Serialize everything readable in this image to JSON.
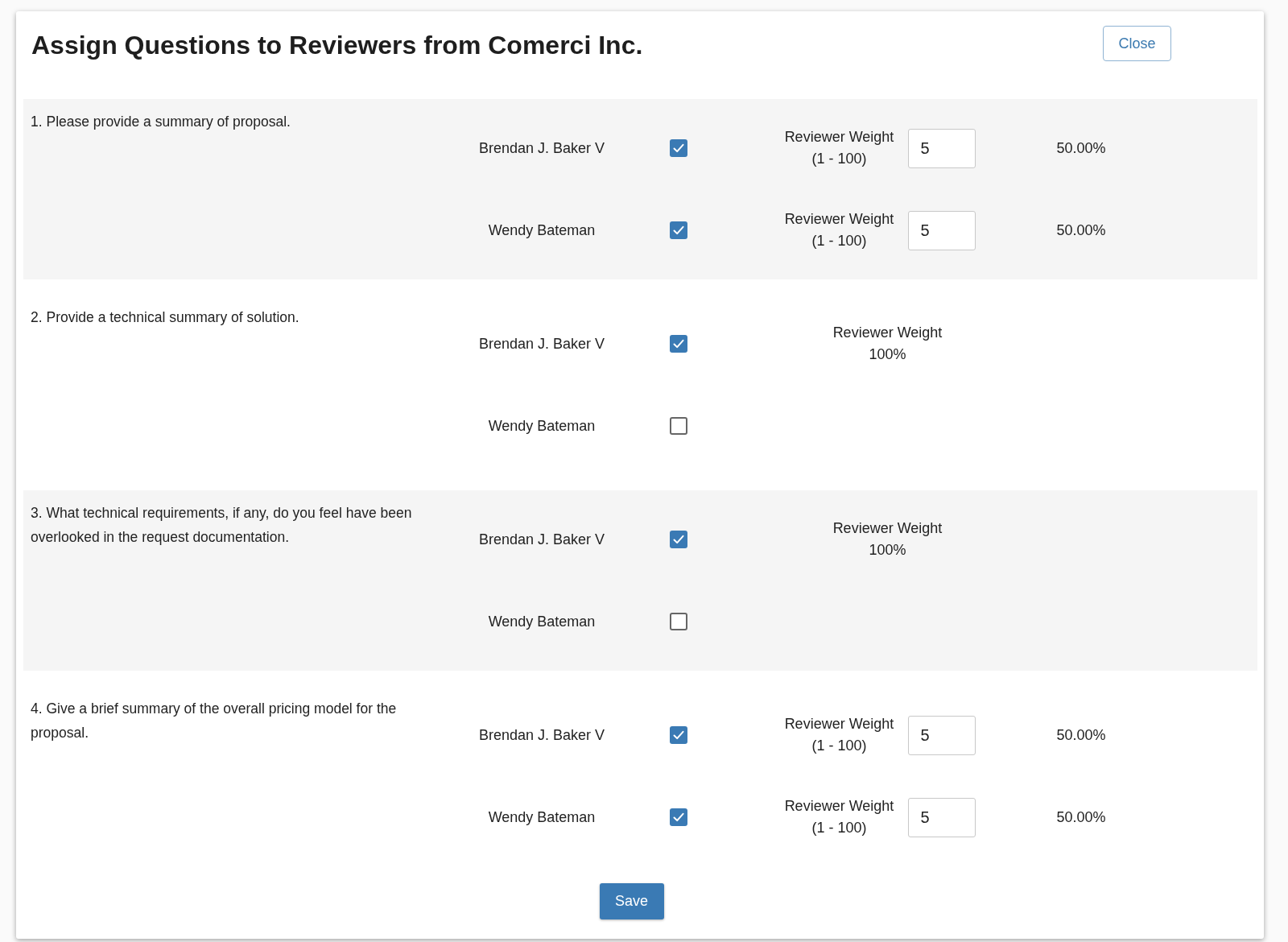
{
  "dialog": {
    "title": "Assign Questions to Reviewers from Comerci Inc.",
    "close_button": "Close"
  },
  "questions": [
    {
      "text": "1. Please provide a summary of proposal.",
      "reviewers": [
        {
          "name": "Brendan J. Baker V",
          "checked": true,
          "kind": "input",
          "weight_label": "Reviewer Weight",
          "weight_note": "(1 - 100)",
          "value": "5",
          "percent": "50.00%"
        },
        {
          "name": "Wendy Bateman",
          "checked": true,
          "kind": "input",
          "weight_label": "Reviewer Weight",
          "weight_note": "(1 - 100)",
          "value": "5",
          "percent": "50.00%"
        }
      ]
    },
    {
      "text": "2. Provide a technical summary of solution.",
      "reviewers": [
        {
          "name": "Brendan J. Baker V",
          "checked": true,
          "kind": "fixed",
          "weight_label": "Reviewer Weight",
          "weight_note": "100%"
        },
        {
          "name": "Wendy Bateman",
          "checked": false,
          "kind": "none"
        }
      ]
    },
    {
      "text": "3. What technical requirements, if any, do you feel have been overlooked in the request documentation.",
      "reviewers": [
        {
          "name": "Brendan J. Baker V",
          "checked": true,
          "kind": "fixed",
          "weight_label": "Reviewer Weight",
          "weight_note": "100%"
        },
        {
          "name": "Wendy Bateman",
          "checked": false,
          "kind": "none"
        }
      ]
    },
    {
      "text": "4. Give a brief summary of the overall pricing model for the proposal.",
      "reviewers": [
        {
          "name": "Brendan J. Baker V",
          "checked": true,
          "kind": "input",
          "weight_label": "Reviewer Weight",
          "weight_note": "(1 - 100)",
          "value": "5",
          "percent": "50.00%"
        },
        {
          "name": "Wendy Bateman",
          "checked": true,
          "kind": "input",
          "weight_label": "Reviewer Weight",
          "weight_note": "(1 - 100)",
          "value": "5",
          "percent": "50.00%"
        }
      ]
    }
  ],
  "save_button": "Save"
}
